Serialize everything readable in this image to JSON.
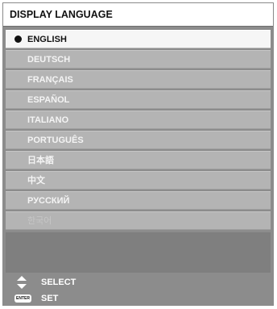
{
  "menu": {
    "title": "DISPLAY LANGUAGE",
    "languages": [
      {
        "label": "ENGLISH",
        "selected": true
      },
      {
        "label": "DEUTSCH"
      },
      {
        "label": "FRANÇAIS"
      },
      {
        "label": "ESPAÑOL"
      },
      {
        "label": "ITALIANO"
      },
      {
        "label": "PORTUGUÊS"
      },
      {
        "label": "日本語"
      },
      {
        "label": "中文"
      },
      {
        "label": "РУССКИЙ"
      },
      {
        "label": "한국어",
        "disabled": true
      }
    ]
  },
  "guide": {
    "select_label": "SELECT",
    "set_label": "SET",
    "enter_key_label": "ENTER",
    "select_icon": "up-down-arrows-icon",
    "set_icon": "enter-key-icon"
  },
  "colors": {
    "panel": "#8c8c8c",
    "item": "#b4b4b4",
    "item_selected": "#f6f6f6",
    "title_bg": "#ffffff"
  }
}
